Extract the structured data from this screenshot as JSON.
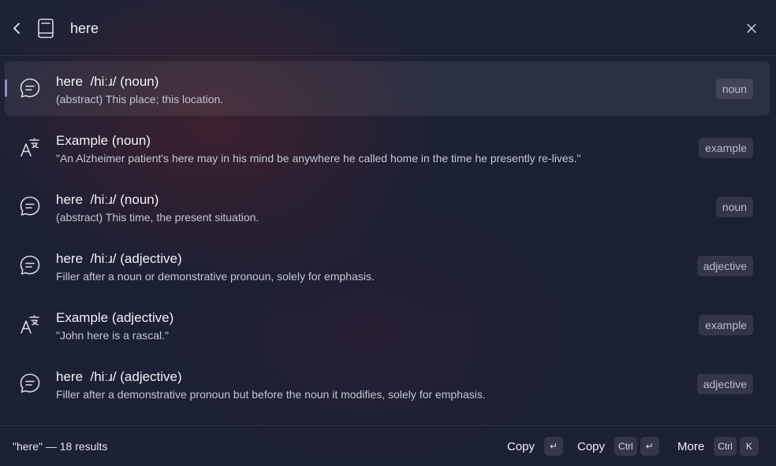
{
  "search": {
    "query": "here"
  },
  "results": [
    {
      "icon": "chat-bubble-icon",
      "title": "here  /hiːɹ/ (noun)",
      "subtitle": "(abstract) This place; this location.",
      "tag": "noun"
    },
    {
      "icon": "translate-icon",
      "title": "Example (noun)",
      "subtitle": "\"An Alzheimer patient's here may in his mind be anywhere he called home in the time he presently re-lives.\"",
      "tag": "example"
    },
    {
      "icon": "chat-bubble-icon",
      "title": "here  /hiːɹ/ (noun)",
      "subtitle": "(abstract) This time, the present situation.",
      "tag": "noun"
    },
    {
      "icon": "chat-bubble-icon",
      "title": "here  /hiːɹ/ (adjective)",
      "subtitle": "Filler after a noun or demonstrative pronoun, solely for emphasis.",
      "tag": "adjective"
    },
    {
      "icon": "translate-icon",
      "title": "Example (adjective)",
      "subtitle": "\"John here is a rascal.\"",
      "tag": "example"
    },
    {
      "icon": "chat-bubble-icon",
      "title": "here  /hiːɹ/ (adjective)",
      "subtitle": "Filler after a demonstrative pronoun but before the noun it modifies, solely for emphasis.",
      "tag": "adjective"
    }
  ],
  "footer": {
    "status": "\"here\" — 18 results",
    "actions": [
      {
        "label": "Copy",
        "keys": [
          "↵"
        ]
      },
      {
        "label": "Copy",
        "keys": [
          "Ctrl",
          "↵"
        ]
      },
      {
        "label": "More",
        "keys": [
          "Ctrl",
          "K"
        ]
      }
    ]
  }
}
